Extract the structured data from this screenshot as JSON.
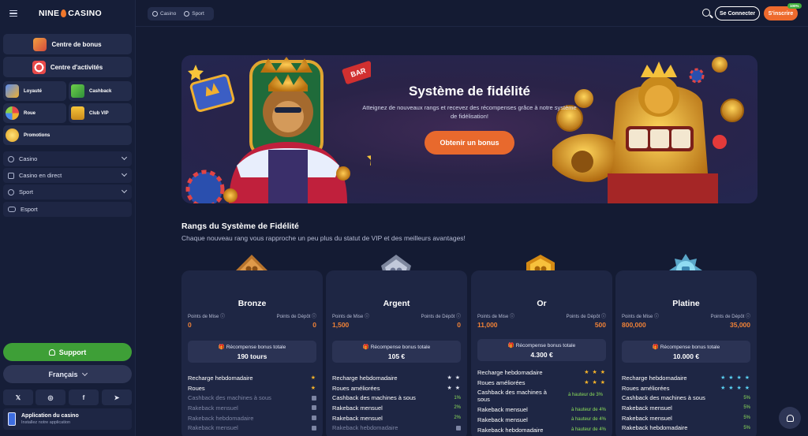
{
  "brand": {
    "logo_left": "NINE",
    "logo_right": "CASINO"
  },
  "sidebar": {
    "wide": [
      {
        "label": "Centre de bonus",
        "icon": "gift-icon"
      },
      {
        "label": "Centre d'activités",
        "icon": "target-icon"
      }
    ],
    "small": [
      {
        "label": "Loyauté",
        "icon": "crown-shield-icon"
      },
      {
        "label": "Cashback",
        "icon": "cash-icon"
      },
      {
        "label": "Roue",
        "icon": "wheel-icon"
      },
      {
        "label": "Club VIP",
        "icon": "crown-icon"
      },
      {
        "label": "Promotions",
        "icon": "coin-icon"
      }
    ],
    "nav": [
      {
        "label": "Casino",
        "icon": "cherry-icon",
        "chevron": true
      },
      {
        "label": "Casino en direct",
        "icon": "live-icon",
        "chevron": true
      },
      {
        "label": "Sport",
        "icon": "ball-icon",
        "chevron": true
      },
      {
        "label": "Esport",
        "icon": "gamepad-icon",
        "chevron": false
      }
    ],
    "support": "Support",
    "language": "Français",
    "social": [
      {
        "label": "𝕏",
        "icon": "x-icon"
      },
      {
        "label": "◎",
        "icon": "instagram-icon"
      },
      {
        "label": "f",
        "icon": "facebook-icon"
      },
      {
        "label": "➤",
        "icon": "telegram-icon"
      }
    ],
    "app": {
      "title": "Application du casino",
      "subtitle": "Installez notre application"
    }
  },
  "topbar": {
    "toggle": [
      "Casino",
      "Sport"
    ],
    "login": "Se Connecter",
    "signup": "S'inscrire",
    "badge": "100%"
  },
  "hero": {
    "title": "Système de fidélité",
    "description": "Atteignez de nouveaux rangs et recevez des récompenses grâce à notre système de fidélisation!",
    "cta": "Obtenir un bonus",
    "sign_text": "BAR"
  },
  "section": {
    "title": "Rangs du Système de Fidélité",
    "subtitle": "Chaque nouveau rang vous rapproche un peu plus du statut de VIP et des meilleurs avantages!"
  },
  "labels": {
    "points_mise": "Points de Mise",
    "points_depot": "Points de Dépôt",
    "reward": "Récompense bonus totale"
  },
  "ranks": [
    {
      "name": "Bronze",
      "mise": "0",
      "depot": "0",
      "reward": "190 tours",
      "features": [
        {
          "label": "Recharge hebdomadaire",
          "value": "★",
          "type": "stars",
          "locked": false
        },
        {
          "label": "Roues",
          "value": "★",
          "type": "stars",
          "locked": false
        },
        {
          "label": "Cashback des machines à sous",
          "value": "",
          "type": "lock",
          "locked": true
        },
        {
          "label": "Rakeback mensuel",
          "value": "",
          "type": "lock",
          "locked": true
        },
        {
          "label": "Rakeback hebdomadaire",
          "value": "",
          "type": "lock",
          "locked": true
        },
        {
          "label": "Rakeback mensuel",
          "value": "",
          "type": "lock",
          "locked": true
        }
      ]
    },
    {
      "name": "Argent",
      "mise": "1,500",
      "depot": "0",
      "reward": "105 €",
      "features": [
        {
          "label": "Recharge hebdomadaire",
          "value": "★ ★",
          "type": "stars",
          "locked": false
        },
        {
          "label": "Roues améliorées",
          "value": "★ ★",
          "type": "stars",
          "locked": false
        },
        {
          "label": "Cashback des machines à sous",
          "value": "1%",
          "type": "pct",
          "locked": false
        },
        {
          "label": "Rakeback mensuel",
          "value": "2%",
          "type": "pct",
          "locked": false
        },
        {
          "label": "Rakeback mensuel",
          "value": "2%",
          "type": "pct",
          "locked": false
        },
        {
          "label": "Rakeback hebdomadaire",
          "value": "",
          "type": "lock",
          "locked": true
        }
      ]
    },
    {
      "name": "Or",
      "mise": "11,000",
      "depot": "500",
      "reward": "4.300 €",
      "features": [
        {
          "label": "Recharge hebdomadaire",
          "value": "★ ★ ★",
          "type": "stars",
          "locked": false
        },
        {
          "label": "Roues améliorées",
          "value": "★ ★ ★",
          "type": "stars",
          "locked": false
        },
        {
          "label": "Cashback des machines à sous",
          "value": "à hauteur de 3%",
          "type": "pct",
          "locked": false
        },
        {
          "label": "Rakeback mensuel",
          "value": "à hauteur de 4%",
          "type": "pct",
          "locked": false
        },
        {
          "label": "Rakeback mensuel",
          "value": "à hauteur de 4%",
          "type": "pct",
          "locked": false
        },
        {
          "label": "Rakeback hebdomadaire",
          "value": "à hauteur de 4%",
          "type": "pct",
          "locked": false
        }
      ]
    },
    {
      "name": "Platine",
      "mise": "800,000",
      "depot": "35,000",
      "reward": "10.000 €",
      "features": [
        {
          "label": "Recharge hebdomadaire",
          "value": "★ ★ ★ ★",
          "type": "stars",
          "locked": false
        },
        {
          "label": "Roues améliorées",
          "value": "★ ★ ★ ★",
          "type": "stars",
          "locked": false
        },
        {
          "label": "Cashback des machines à sous",
          "value": "5%",
          "type": "pct",
          "locked": false
        },
        {
          "label": "Rakeback mensuel",
          "value": "5%",
          "type": "pct",
          "locked": false
        },
        {
          "label": "Rakeback mensuel",
          "value": "5%",
          "type": "pct",
          "locked": false
        },
        {
          "label": "Rakeback hebdomadaire",
          "value": "5%",
          "type": "pct",
          "locked": false
        }
      ]
    }
  ],
  "colors": {
    "accent": "#ee6a2d",
    "support": "#3e9f37",
    "value": "#f08237",
    "percent": "#8ce05a"
  }
}
